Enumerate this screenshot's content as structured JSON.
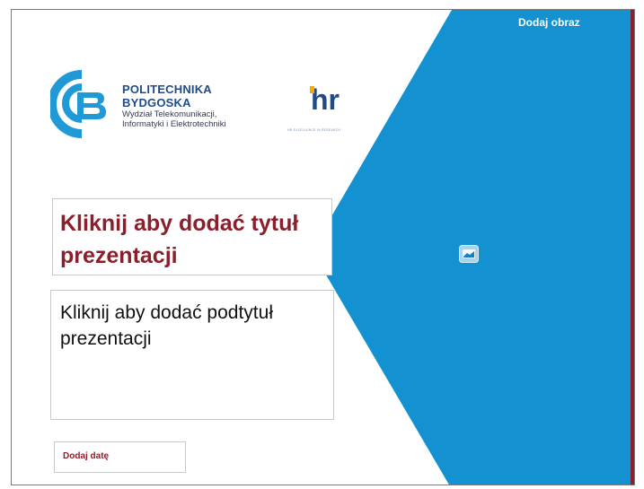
{
  "slide": {
    "add_image_label": "Dodaj obraz",
    "title_placeholder": "Kliknij aby dodać tytuł prezentacji",
    "subtitle_placeholder": "Kliknij aby dodać podtytuł prezentacji",
    "date_placeholder": "Dodaj datę"
  },
  "logo": {
    "name_line1": "POLITECHNIKA",
    "name_line2": "BYDGOSKA",
    "faculty_line1": "Wydział Telekomunikacji,",
    "faculty_line2": "Informatyki i Elektrotechniki",
    "hr_badge": "hr",
    "hr_caption": "HR EXCELLENCE IN RESEARCH"
  },
  "icons": {
    "image_placeholder": "image-icon",
    "university_logo": "pb-logo",
    "hr_logo": "hr-excellence-logo"
  },
  "colors": {
    "accent_blue": "#1391d1",
    "brand_maroon": "#8b1f2c",
    "logo_navy": "#1f4b8a"
  }
}
